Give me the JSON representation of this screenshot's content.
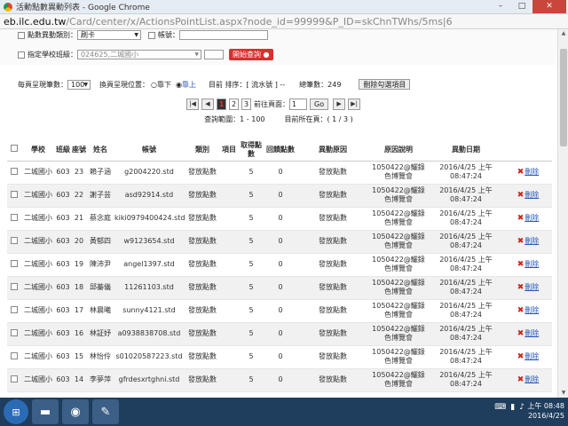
{
  "window": {
    "title": "活動點數異動列表 - Google Chrome",
    "minimize": "–",
    "maximize": "□",
    "close": "✕"
  },
  "address": {
    "host": "eb.ilc.edu.tw",
    "path": "/Card/center/x/ActionsPointList.aspx?node_id=99999&P_ID=skChnTWhs/5ms|6"
  },
  "filter": {
    "type_label": "點數異動類別：",
    "type_value": "刷卡",
    "account_label": "帳號：",
    "account_value": "",
    "school_label": "指定學校班級：",
    "school_value": "024625,二城國小",
    "search_button": "開始查詢"
  },
  "options": {
    "per_page_label": "每頁呈現筆數：",
    "per_page_value": "100",
    "position_label": "換頁呈現位置：",
    "position_bottom": "靠下",
    "position_top": "靠上",
    "sort_label": "目前 排序：[ 流水號 ] --",
    "total_label": "總筆數：249",
    "delete_selected": "刪除勾選項目"
  },
  "pager": {
    "page1": "1",
    "page2": "2",
    "page3": "3",
    "goto_label": "前往頁面：",
    "goto_value": "1",
    "go_button": "Go",
    "current_label": "目前所在頁：( 1 / 3 )"
  },
  "query_range": "查詢範圍：1 - 100",
  "table": {
    "headers": [
      "學校",
      "班級",
      "座號",
      "姓名",
      "帳號",
      "類別",
      "項目",
      "取得點數",
      "回饋點數",
      "異動原因",
      "原因說明",
      "異動日期"
    ],
    "delete_label": "刪除",
    "rows": [
      {
        "school": "二城國小",
        "cls": "603",
        "seat": "23",
        "name": "賴子涵",
        "account": "g2004220.std",
        "type": "發放點數",
        "item": "",
        "get": "5",
        "back": "0",
        "reason": "發放點數",
        "desc": "1050422@鱺錄色博覽會",
        "date": "2016/4/25 上午 08:47:24"
      },
      {
        "school": "二城國小",
        "cls": "603",
        "seat": "22",
        "name": "謝子芸",
        "account": "asd92914.std",
        "type": "發放點數",
        "item": "",
        "get": "5",
        "back": "0",
        "reason": "發放點數",
        "desc": "1050422@鱺錄色博覽會",
        "date": "2016/4/25 上午 08:47:24"
      },
      {
        "school": "二城國小",
        "cls": "603",
        "seat": "21",
        "name": "蔡念庭",
        "account": "kiki0979400424.std",
        "type": "發放點數",
        "item": "",
        "get": "5",
        "back": "0",
        "reason": "發放點數",
        "desc": "1050422@鱺錄色博覽會",
        "date": "2016/4/25 上午 08:47:24"
      },
      {
        "school": "二城國小",
        "cls": "603",
        "seat": "20",
        "name": "黃郁四",
        "account": "w9123654.std",
        "type": "發放點數",
        "item": "",
        "get": "5",
        "back": "0",
        "reason": "發放點數",
        "desc": "1050422@鱺錄色博覽會",
        "date": "2016/4/25 上午 08:47:24"
      },
      {
        "school": "二城國小",
        "cls": "603",
        "seat": "19",
        "name": "陳沛尹",
        "account": "angel1397.std",
        "type": "發放點數",
        "item": "",
        "get": "5",
        "back": "0",
        "reason": "發放點數",
        "desc": "1050422@鱺錄色博覽會",
        "date": "2016/4/25 上午 08:47:24"
      },
      {
        "school": "二城國小",
        "cls": "603",
        "seat": "18",
        "name": "邱蓁儀",
        "account": "11261103.std",
        "type": "發放點數",
        "item": "",
        "get": "5",
        "back": "0",
        "reason": "發放點數",
        "desc": "1050422@鱺錄色博覽會",
        "date": "2016/4/25 上午 08:47:24"
      },
      {
        "school": "二城國小",
        "cls": "603",
        "seat": "17",
        "name": "林晨曦",
        "account": "sunny4121.std",
        "type": "發放點數",
        "item": "",
        "get": "5",
        "back": "0",
        "reason": "發放點數",
        "desc": "1050422@鱺錄色博覽會",
        "date": "2016/4/25 上午 08:47:24"
      },
      {
        "school": "二城國小",
        "cls": "603",
        "seat": "16",
        "name": "林証妤",
        "account": "a0938838708.std",
        "type": "發放點數",
        "item": "",
        "get": "5",
        "back": "0",
        "reason": "發放點數",
        "desc": "1050422@鱺錄色博覽會",
        "date": "2016/4/25 上午 08:47:24"
      },
      {
        "school": "二城國小",
        "cls": "603",
        "seat": "15",
        "name": "林怡伶",
        "account": "s01020587223.std",
        "type": "發放點數",
        "item": "",
        "get": "5",
        "back": "0",
        "reason": "發放點數",
        "desc": "1050422@鱺錄色博覽會",
        "date": "2016/4/25 上午 08:47:24"
      },
      {
        "school": "二城國小",
        "cls": "603",
        "seat": "14",
        "name": "李夢萍",
        "account": "gfrdesxrtghni.std",
        "type": "發放點數",
        "item": "",
        "get": "5",
        "back": "0",
        "reason": "發放點數",
        "desc": "1050422@鱺錄色博覽會",
        "date": "2016/4/25 上午 08:47:24"
      }
    ]
  },
  "taskbar": {
    "time": "上午 08:48",
    "date": "2016/4/25"
  }
}
